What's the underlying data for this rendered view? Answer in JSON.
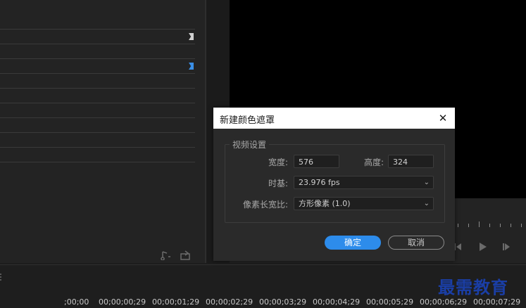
{
  "dialog": {
    "title": "新建颜色遮罩",
    "close_glyph": "✕",
    "group_title": "视频设置",
    "width_label": "宽度:",
    "width_value": "576",
    "height_label": "高度:",
    "height_value": "324",
    "timebase_label": "时基:",
    "timebase_value": "23.976 fps",
    "pixel_aspect_label": "像素长宽比:",
    "pixel_aspect_value": "方形像素 (1.0)",
    "ok_label": "确定",
    "cancel_label": "取消"
  },
  "timeline": {
    "timecodes": [
      ";00;00",
      "00;00;00;29",
      "00;00;01;29",
      "00;00;02;29",
      "00;00;03;29",
      "00;00;04;29",
      "00;00;05;29",
      "00;00;06;29",
      "00;00;07;29"
    ]
  },
  "icons": {
    "marker_white": "marker-icon",
    "marker_blue": "marker-icon",
    "dropdown": "chevron-down-icon",
    "step_back": "step-back-icon",
    "play": "play-icon",
    "step_forward": "step-forward-icon"
  },
  "colors": {
    "accent": "#2d8ceb",
    "marker_blue": "#3b8fe6",
    "monitor_bg": "#000000"
  },
  "watermark": {
    "text": "最需教育"
  }
}
